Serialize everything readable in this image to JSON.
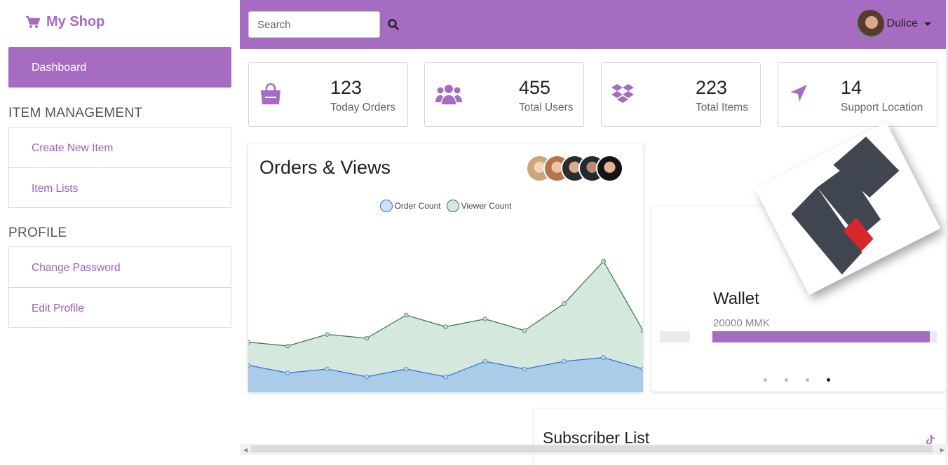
{
  "brand": {
    "name": "My Shop",
    "icon": "shopping-cart-icon"
  },
  "sidebar": {
    "dashboard_label": "Dashboard",
    "sections": [
      {
        "title": "ITEM MANAGEMENT",
        "items": [
          {
            "label": "Create New Item"
          },
          {
            "label": "Item Lists"
          }
        ]
      },
      {
        "title": "PROFILE",
        "items": [
          {
            "label": "Change Password"
          },
          {
            "label": "Edit Profile"
          }
        ]
      }
    ]
  },
  "topbar": {
    "search_placeholder": "Search",
    "user_name": "Dulice"
  },
  "stats": [
    {
      "value": "123",
      "label": "Today Orders",
      "icon": "shopping-bag-icon"
    },
    {
      "value": "455",
      "label": "Total Users",
      "icon": "users-icon"
    },
    {
      "value": "223",
      "label": "Total Items",
      "icon": "dropbox-icon"
    },
    {
      "value": "14",
      "label": "Support Location",
      "icon": "location-arrow-icon"
    }
  ],
  "chart_card": {
    "title": "Orders & Views"
  },
  "chart_data": {
    "type": "area",
    "x": [
      0,
      1,
      2,
      3,
      4,
      5,
      6,
      7,
      8,
      9,
      10
    ],
    "ylim": [
      0,
      10
    ],
    "series": [
      {
        "name": "Order Count",
        "values": [
          1.4,
          1.0,
          1.2,
          0.8,
          1.2,
          0.8,
          1.6,
          1.2,
          1.6,
          1.8,
          1.2
        ]
      },
      {
        "name": "Viewer Count",
        "values": [
          2.6,
          2.4,
          3.0,
          2.8,
          4.0,
          3.4,
          3.8,
          3.2,
          4.6,
          6.8,
          3.2
        ]
      }
    ],
    "colors": {
      "order_fill": "#a9cde8",
      "order_line": "#2f6fe0",
      "viewer_fill": "#d4e8dd",
      "viewer_line": "#2d7a4a"
    }
  },
  "wallet": {
    "title": "Wallet",
    "amount": "20000 MMK",
    "progress": 0.97,
    "slide_count": 4,
    "active_slide": 3
  },
  "subscriber": {
    "title": "Subscriber List"
  },
  "colors": {
    "accent": "#a56cc1"
  }
}
